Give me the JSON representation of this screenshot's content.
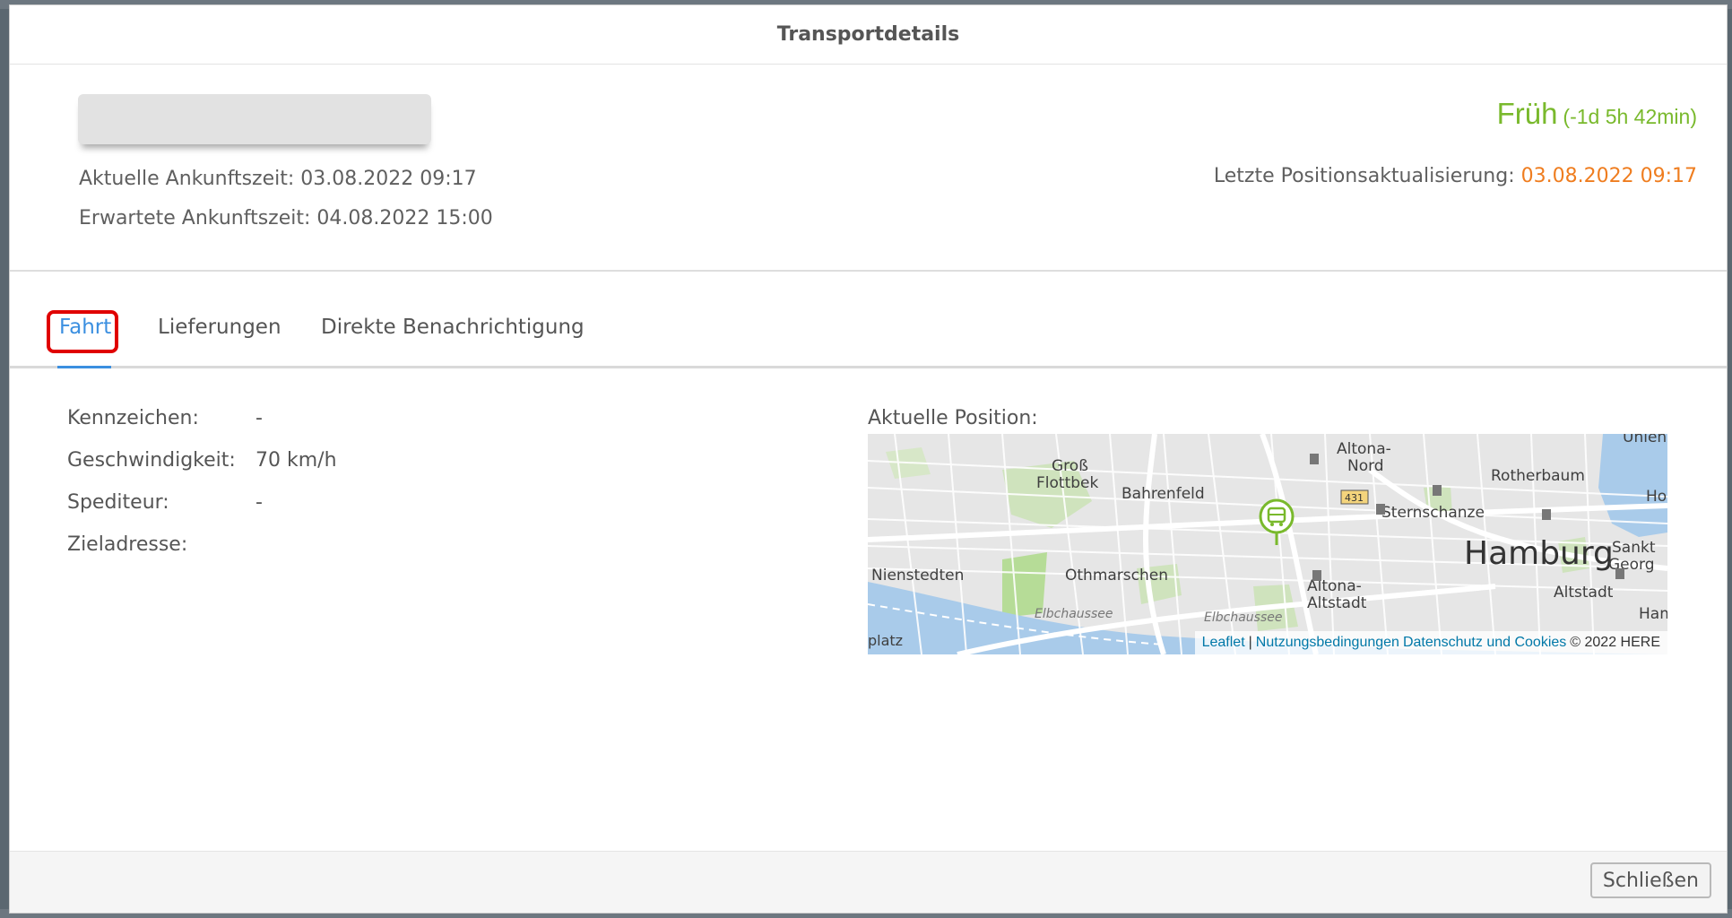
{
  "modal": {
    "title": "Transportdetails"
  },
  "summary": {
    "status": "Früh",
    "status_detail": "(-1d 5h 42min)",
    "status_color": "#79b92c",
    "actual_arrival_label": "Aktuelle Ankunftszeit:",
    "actual_arrival_value": "03.08.2022 09:17",
    "expected_arrival_label": "Erwartete Ankunftszeit:",
    "expected_arrival_value": "04.08.2022 15:00",
    "last_position_label": "Letzte Positionsaktualisierung:",
    "last_position_value": "03.08.2022 09:17",
    "last_position_color": "#ef7d1f"
  },
  "tabs": [
    {
      "label": "Fahrt",
      "active": true
    },
    {
      "label": "Lieferungen",
      "active": false
    },
    {
      "label": "Direkte Benachrichtigung",
      "active": false
    }
  ],
  "details": {
    "license_plate_label": "Kennzeichen:",
    "license_plate_value": "-",
    "speed_label": "Geschwindigkeit:",
    "speed_value": "70 km/h",
    "carrier_label": "Spediteur:",
    "carrier_value": "-",
    "destination_label": "Zieladresse:",
    "destination_value": ""
  },
  "map": {
    "label": "Aktuelle Position:",
    "places": {
      "altona_nord_1": "Altona-",
      "altona_nord_2": "Nord",
      "gross_flottbek_1": "Groß",
      "gross_flottbek_2": "Flottbek",
      "bahrenfeld": "Bahrenfeld",
      "rotherbaum": "Rotherbaum",
      "sternschanze": "Sternschanze",
      "hamburg": "Hamburg",
      "sankt_georg_1": "Sankt",
      "sankt_georg_2": "Georg",
      "nienstedten": "Nienstedten",
      "othmarschen": "Othmarschen",
      "altona_altstadt_1": "Altona-",
      "altona_altstadt_2": "Altstadt",
      "altstadt": "Altstadt",
      "elbchaussee_1": "Elbchaussee",
      "elbchaussee_2": "Elbchaussee",
      "uhlenhorst_partial": "Uhlenh",
      "ho_partial": "Ho",
      "ham_partial": "Ham",
      "platz_partial": "platz",
      "road_shield": "431"
    },
    "attribution": {
      "leaflet": "Leaflet",
      "separator": "|",
      "terms": "Nutzungsbedingungen",
      "privacy": "Datenschutz und Cookies",
      "copyright": "© 2022 HERE"
    },
    "marker_icon": "truck-marker-icon"
  },
  "footer": {
    "close_label": "Schließen"
  }
}
